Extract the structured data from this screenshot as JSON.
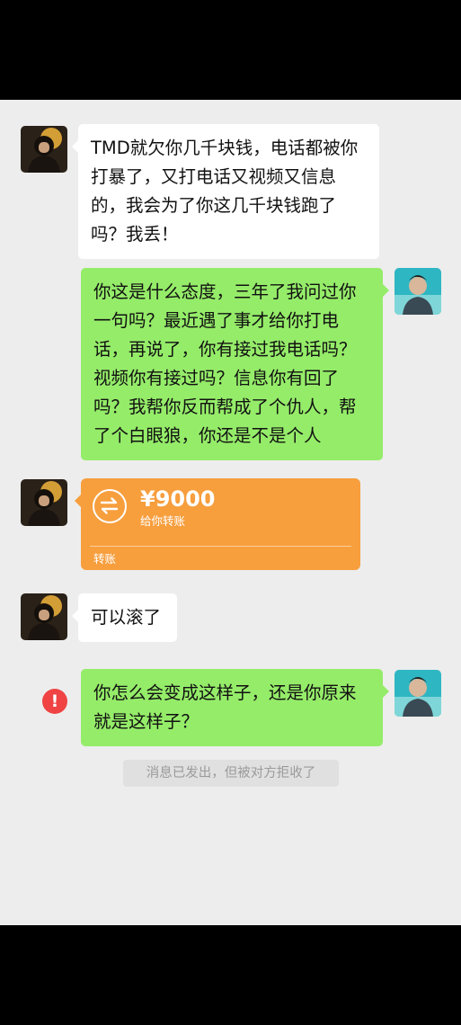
{
  "conversation": {
    "messages": [
      {
        "from": "other",
        "text": "TMD就欠你几千块钱，电话都被你打暴了，又打电话又视频又信息的，我会为了你这几千块钱跑了吗？我丢！"
      },
      {
        "from": "self",
        "text": "你这是什么态度，三年了我问过你一句吗？最近遇了事才给你打电话，再说了，你有接过我电话吗？视频你有接过吗？信息你有回了吗？我帮你反而帮成了个仇人，帮了个白眼狼，你还是不是个人"
      },
      {
        "from": "other",
        "type": "transfer",
        "amount": "¥9000",
        "subtitle": "给你转账",
        "footer": "转账",
        "color": "#f79e3d"
      },
      {
        "from": "other",
        "text": "可以滚了"
      },
      {
        "from": "self",
        "text": "你怎么会变成这样子，还是你原来就是这样子？",
        "status": "failed",
        "status_icon": "exclamation-icon",
        "status_mark": "!"
      }
    ],
    "system_notice": "消息已发出，但被对方拒收了"
  },
  "colors": {
    "chat_background": "#ededed",
    "self_bubble": "#95ec69",
    "other_bubble": "#ffffff",
    "transfer_card": "#f79e3d",
    "error": "#f04343"
  }
}
